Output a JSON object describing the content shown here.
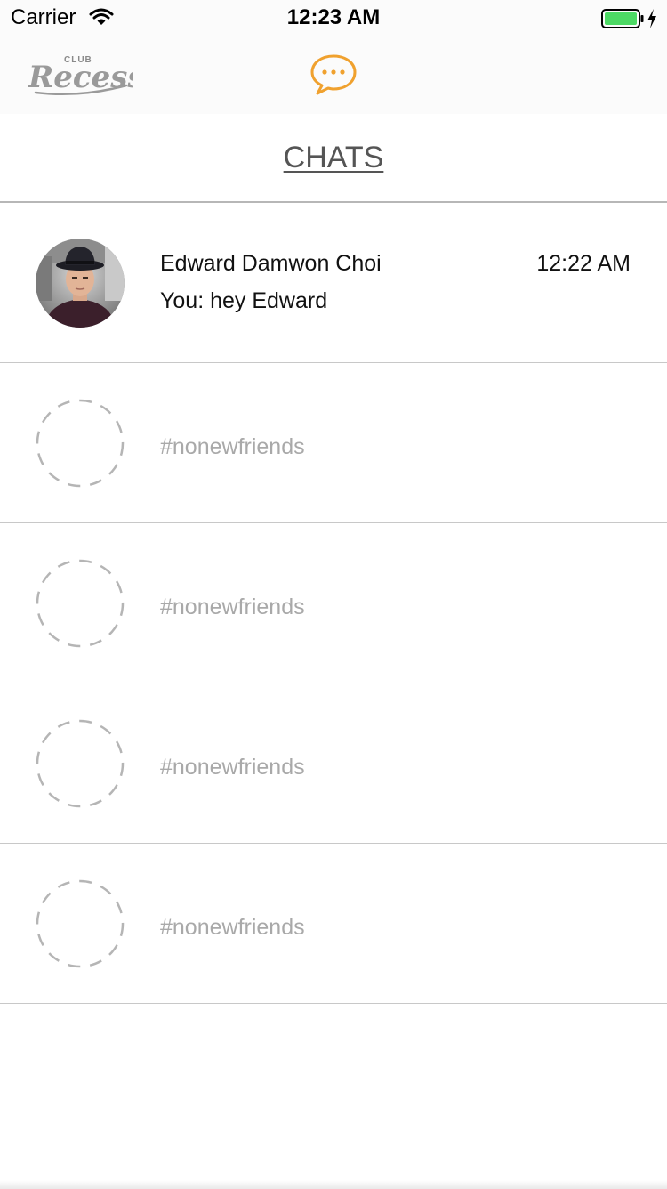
{
  "status_bar": {
    "carrier": "Carrier",
    "time": "12:23 AM"
  },
  "header": {
    "logo_small": "CLUB",
    "logo_main": "Recess",
    "chat_icon": "chat-bubble-icon"
  },
  "page": {
    "title": "CHATS"
  },
  "chats": [
    {
      "name": "Edward Damwon Choi",
      "last_message": "You: hey Edward",
      "time": "12:22 AM"
    }
  ],
  "placeholders": [
    {
      "label": "#nonewfriends"
    },
    {
      "label": "#nonewfriends"
    },
    {
      "label": "#nonewfriends"
    },
    {
      "label": "#nonewfriends"
    }
  ],
  "colors": {
    "accent": "#f0a12e",
    "placeholder_text": "#a9a9a9",
    "battery": "#4cd964"
  }
}
